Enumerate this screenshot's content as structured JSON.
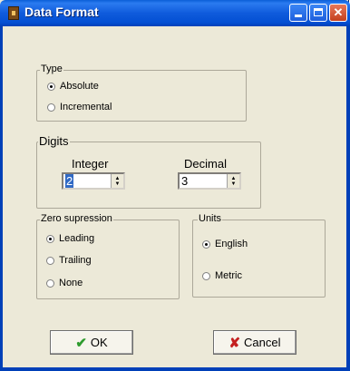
{
  "window": {
    "title": "Data Format",
    "controls": [
      "minimize",
      "maximize",
      "close"
    ]
  },
  "type_group": {
    "legend": "Type",
    "options": [
      {
        "label": "Absolute",
        "checked": true
      },
      {
        "label": "Incremental",
        "checked": false
      }
    ]
  },
  "digits_group": {
    "legend": "Digits",
    "integer_label": "Integer",
    "integer_value": "2",
    "decimal_label": "Decimal",
    "decimal_value": "3"
  },
  "zero_group": {
    "legend": "Zero supression",
    "options": [
      {
        "label": "Leading",
        "checked": true
      },
      {
        "label": "Trailing",
        "checked": false
      },
      {
        "label": "None",
        "checked": false
      }
    ]
  },
  "units_group": {
    "legend": "Units",
    "options": [
      {
        "label": "English",
        "checked": true
      },
      {
        "label": "Metric",
        "checked": false
      }
    ]
  },
  "buttons": {
    "ok": "OK",
    "cancel": "Cancel"
  },
  "icons": {
    "app": "app-icon",
    "ok": "checkmark-icon",
    "cancel": "x-icon"
  },
  "colors": {
    "titlebar": "#0450d3",
    "dialog_bg": "#ece9d8",
    "ok_icon": "#2e9b2e",
    "cancel_icon": "#c42020"
  }
}
